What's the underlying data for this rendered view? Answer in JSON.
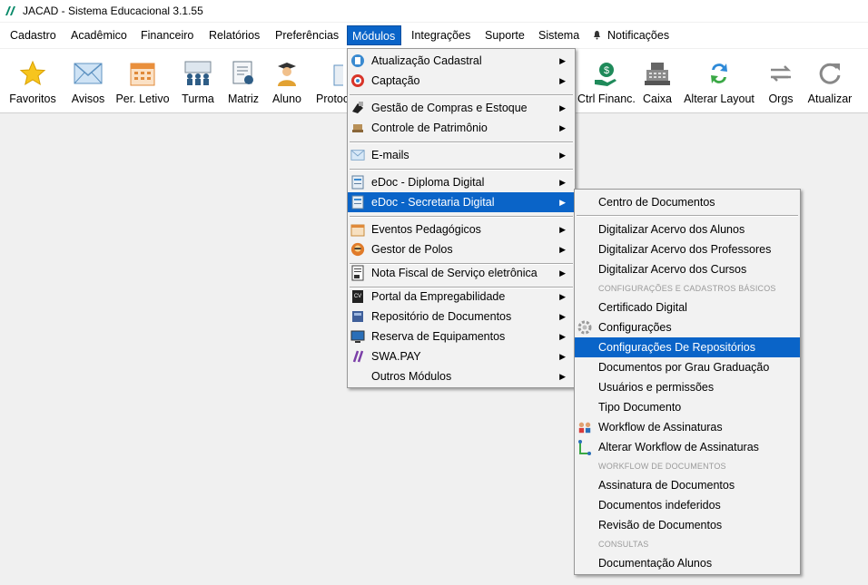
{
  "window": {
    "title": "JACAD - Sistema Educacional 3.1.55"
  },
  "menubar": {
    "items": [
      "Cadastro",
      "Acadêmico",
      "Financeiro",
      "Relatórios",
      "Preferências",
      "Módulos",
      "Integrações",
      "Suporte",
      "Sistema",
      "Notificações"
    ]
  },
  "toolbar": {
    "buttons": [
      {
        "label": "Favoritos",
        "icon": "star-icon"
      },
      {
        "label": "Avisos",
        "icon": "envelope-icon"
      },
      {
        "label": "Per. Letivo",
        "icon": "calendar-icon"
      },
      {
        "label": "Turma",
        "icon": "class-group-icon"
      },
      {
        "label": "Matriz",
        "icon": "matrix-certificate-icon"
      },
      {
        "label": "Aluno",
        "icon": "student-icon"
      },
      {
        "label": "Protoc",
        "icon": "protocol-icon"
      },
      {
        "label": "Ctrl Financ.",
        "icon": "money-hand-icon"
      },
      {
        "label": "Caixa",
        "icon": "cash-register-icon"
      },
      {
        "label": "Alterar Layout",
        "icon": "swap-layout-icon"
      },
      {
        "label": "Orgs",
        "icon": "swap-arrows-icon"
      },
      {
        "label": "Atualizar",
        "icon": "refresh-icon"
      }
    ]
  },
  "modulos_menu": {
    "items": [
      {
        "label": "Atualização Cadastral",
        "icon": "registry-update-icon",
        "submenu": true
      },
      {
        "label": "Captação",
        "icon": "capture-icon",
        "submenu": true
      },
      {
        "label": "Gestão de Compras e Estoque",
        "icon": "purchase-icon",
        "submenu": true
      },
      {
        "label": "Controle de Patrimônio",
        "icon": "heritage-icon",
        "submenu": true
      },
      {
        "label": "E-mails",
        "icon": "email-icon",
        "submenu": true
      },
      {
        "label": "eDoc - Diploma Digital",
        "icon": "diploma-icon",
        "submenu": true
      },
      {
        "label": "eDoc - Secretaria Digital",
        "icon": "secretaria-icon",
        "submenu": true,
        "highlighted": true
      },
      {
        "label": "Eventos Pedagógicos",
        "icon": "events-icon",
        "submenu": true
      },
      {
        "label": "Gestor de Polos",
        "icon": "poles-icon",
        "submenu": true
      },
      {
        "label": "Nota Fiscal de Serviço eletrônica",
        "icon": "invoice-icon",
        "submenu": true
      },
      {
        "label": "Portal da Empregabilidade",
        "icon": "cv-icon",
        "submenu": true
      },
      {
        "label": "Repositório de Documentos",
        "icon": "repository-icon",
        "submenu": true
      },
      {
        "label": "Reserva de Equipamentos",
        "icon": "monitor-icon",
        "submenu": true
      },
      {
        "label": "SWA.PAY",
        "icon": "swapay-icon",
        "submenu": true
      },
      {
        "label": "Outros Módulos",
        "icon": "",
        "submenu": true
      }
    ]
  },
  "secretaria_menu": {
    "items": [
      {
        "label": "Centro de Documentos"
      },
      {
        "label": "Digitalizar Acervo dos Alunos"
      },
      {
        "label": "Digitalizar Acervo dos Professores"
      },
      {
        "label": "Digitalizar Acervo dos Cursos"
      },
      {
        "header": "CONFIGURAÇÕES E CADASTROS BÁSICOS"
      },
      {
        "label": "Certificado Digital"
      },
      {
        "label": "Configurações",
        "icon": "gear-icon"
      },
      {
        "label": "Configurações De Repositórios",
        "highlighted": true
      },
      {
        "label": "Documentos por Grau Graduação"
      },
      {
        "label": "Usuários e permissões"
      },
      {
        "label": "Tipo Documento"
      },
      {
        "label": "Workflow de Assinaturas",
        "icon": "workflow-users-icon"
      },
      {
        "label": "Alterar Workflow de Assinaturas",
        "icon": "workflow-edit-icon"
      },
      {
        "header": "WORKFLOW DE DOCUMENTOS"
      },
      {
        "label": "Assinatura de Documentos"
      },
      {
        "label": "Documentos indeferidos"
      },
      {
        "label": "Revisão de Documentos"
      },
      {
        "header": "CONSULTAS"
      },
      {
        "label": "Documentação Alunos"
      }
    ]
  },
  "colors": {
    "highlight": "#0a64c8",
    "menu_bg": "#f2f2f2",
    "work_area": "#f0f0f0"
  }
}
